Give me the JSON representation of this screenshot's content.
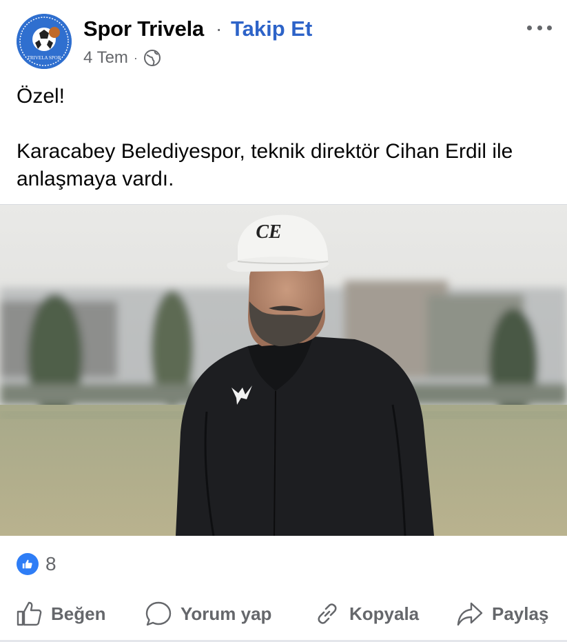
{
  "post": {
    "page_name": "Spor Trivela",
    "separator": "·",
    "follow_label": "Takip Et",
    "date": "4 Tem",
    "meta_separator": "·",
    "privacy_icon": "globe-icon",
    "more_icon": "more-horizontal-icon",
    "avatar_text": "TRIVELA SPOR",
    "paragraphs": [
      "Özel!",
      "Karacabey Belediyespor, teknik direktör Cihan Erdil ile anlaşmaya vardı."
    ],
    "photo_cap_logo": "CE",
    "photo_jacket_logo_icon": "puma-icon"
  },
  "reactions": {
    "icon": "like-icon",
    "count": "8"
  },
  "actions": [
    {
      "label": "Beğen",
      "icon": "thumbs-up-icon"
    },
    {
      "label": "Yorum yap",
      "icon": "comment-icon"
    },
    {
      "label": "Kopyala",
      "icon": "link-icon"
    },
    {
      "label": "Paylaş",
      "icon": "share-icon"
    }
  ],
  "colors": {
    "accent": "#2d63c8",
    "secondary_text": "#65676b",
    "like_blue": "#2e7df6"
  }
}
